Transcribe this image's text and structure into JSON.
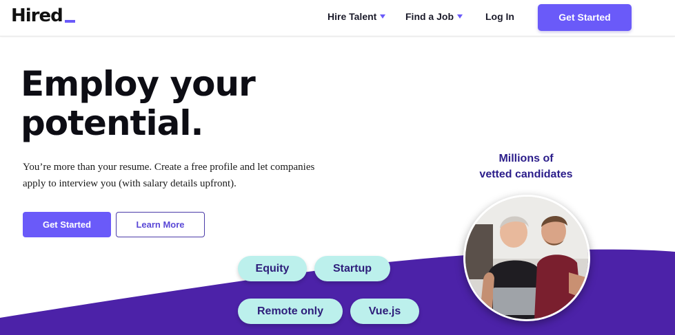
{
  "nav": {
    "logo": "Hired",
    "hire_talent": "Hire Talent",
    "find_a_job": "Find a Job",
    "log_in": "Log In",
    "get_started": "Get Started"
  },
  "hero": {
    "headline_line1": "Employ your",
    "headline_line2": "potential.",
    "subtext_line1": "You’re more than your resume. Create a free profile and let companies",
    "subtext_line2": "apply to interview you (with salary details upfront).",
    "primary_button": "Get Started",
    "secondary_button": "Learn More"
  },
  "tags": [
    "Equity",
    "Startup",
    "Remote only",
    "Vue.js"
  ],
  "side_panel": {
    "caption_line1": "Millions of",
    "caption_line2": "vetted candidates"
  },
  "colors": {
    "brand_purple": "#6a5af9",
    "wave_purple": "#4c22a8",
    "tag_mint": "#bcf0ec",
    "dark_text": "#0d0d14"
  },
  "icons": {
    "dropdown": "caret-down-icon"
  }
}
